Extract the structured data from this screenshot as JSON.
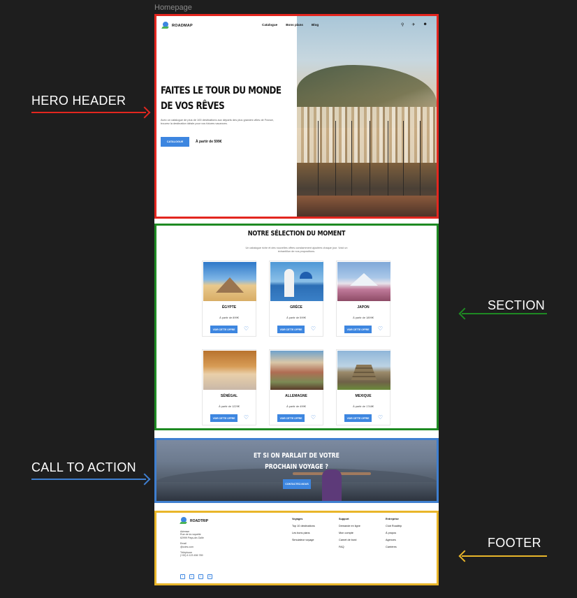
{
  "frame_label": "Homepage",
  "annotations": {
    "hero": "HERO HEADER",
    "section": "SECTION",
    "cta": "CALL TO ACTION",
    "footer": "FOOTER"
  },
  "colors": {
    "hero_outline": "#e3261f",
    "section_outline": "#1e8a23",
    "cta_outline": "#3f7fd0",
    "footer_outline": "#e9b62a",
    "accent": "#3d86e0"
  },
  "nav": {
    "brand": "ROADMAP",
    "links": [
      "Catalogue",
      "Bons plans",
      "Blog"
    ],
    "icons": [
      "search-icon",
      "plane-icon",
      "user-icon"
    ]
  },
  "hero": {
    "title_line1": "FAITES LE TOUR DU MONDE",
    "title_line2": "DE VOS RÊVES",
    "description": "Avec un catalogue de plus de 100 destinations aux départs des plus grandes villes de France, trouvez la destination idéale pour vos futures vacances.",
    "button": "CATALOGUE",
    "price": "À partir de 599€"
  },
  "selection": {
    "title": "NOTRE SÉLECTION DU MOMENT",
    "subtitle": "Un catalogue riche et des nouvelles offres constamment ajoutées chaque jour. Voici un échantillon de nos propositions.",
    "button_label": "VOIR CETTE OFFRE",
    "cards": [
      {
        "name": "ÉGYPTE",
        "price": "À partir de 899€"
      },
      {
        "name": "GRÈCE",
        "price": "À partir de 599€"
      },
      {
        "name": "JAPON",
        "price": "À partir de 1899€"
      },
      {
        "name": "SÉNÉGAL",
        "price": "À partir de 1229€"
      },
      {
        "name": "ALLEMAGNE",
        "price": "À partir de 499€"
      },
      {
        "name": "MEXIQUE",
        "price": "À partir de 1748€"
      }
    ]
  },
  "cta": {
    "title_line1": "ET SI ON PARLAIT DE VOTRE",
    "title_line2": "PROCHAIN VOYAGE ?",
    "button": "CONTACTEZ-NOUS"
  },
  "footer": {
    "brand": "ROADTRIP",
    "address_label": "Adresse",
    "address_line1": "Rue de la roquette",
    "address_line2": "62999 Pays-de-Galle",
    "email_label": "Email",
    "email": "@cdes.com",
    "phone_label": "Téléphone",
    "phone": "(+33) 6 123 456 789",
    "columns": [
      {
        "heading": "Voyages",
        "items": [
          "Top 10 destinations",
          "Les bons plans",
          "Simulateur voyage"
        ]
      },
      {
        "heading": "Support",
        "items": [
          "Demande en ligne",
          "Mon compte",
          "Carnet de bord",
          "FAQ"
        ]
      },
      {
        "heading": "Entreprise",
        "items": [
          "Club Roadtrip",
          "À propos",
          "Agences",
          "Carrières"
        ]
      }
    ],
    "social_icons": [
      "facebook-icon",
      "instagram-icon",
      "twitter-icon",
      "linkedin-icon"
    ]
  }
}
